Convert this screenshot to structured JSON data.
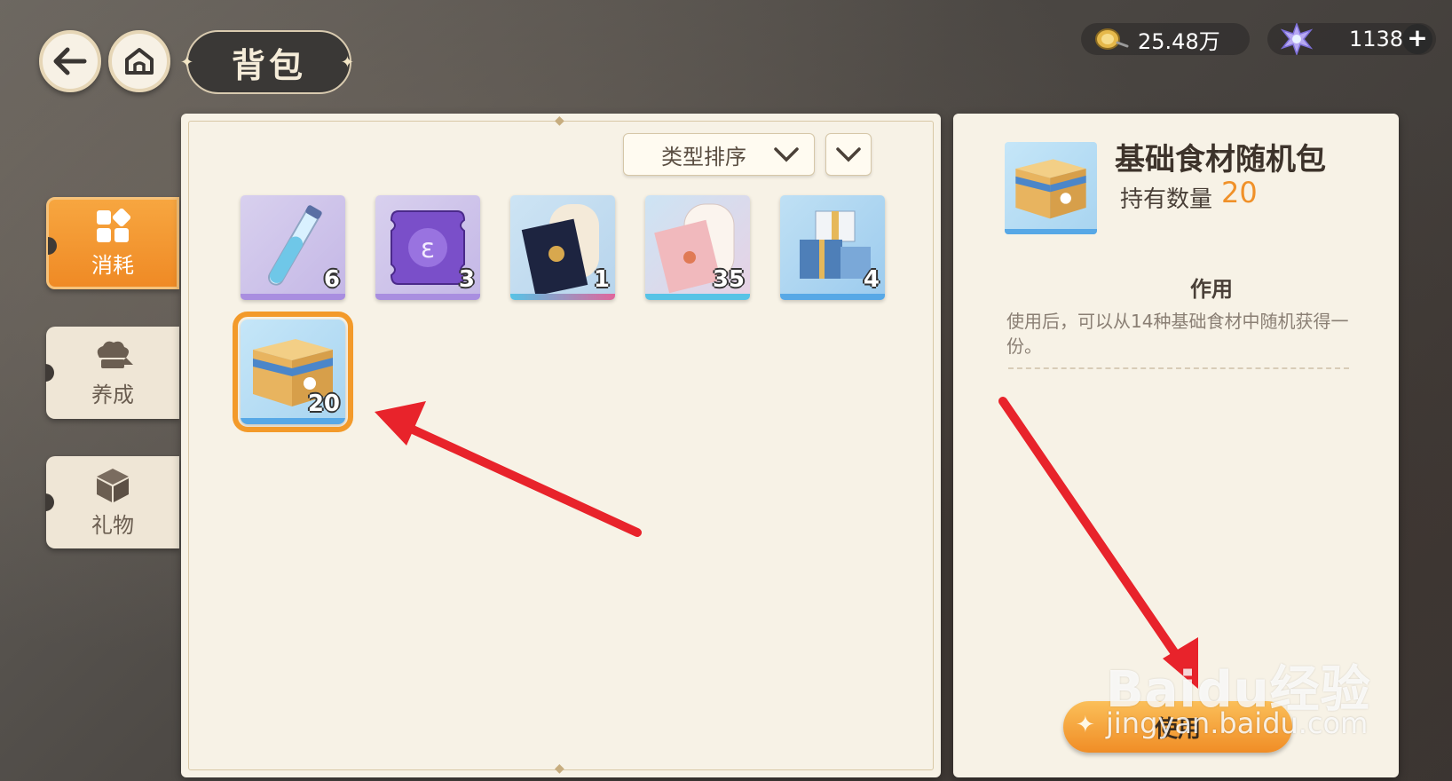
{
  "header": {
    "title": "背包",
    "back_icon": "back-arrow-icon",
    "home_icon": "home-icon"
  },
  "currency": {
    "gold": {
      "icon": "gold-coin-icon",
      "value": "25.48万"
    },
    "crystal": {
      "icon": "crystal-icon",
      "value": "1138"
    },
    "add_label": "+"
  },
  "sidebar": {
    "tabs": [
      {
        "label": "消耗",
        "icon": "grid-icon",
        "active": true
      },
      {
        "label": "养成",
        "icon": "chef-hat-icon",
        "active": false
      },
      {
        "label": "礼物",
        "icon": "gift-box-icon",
        "active": false
      }
    ]
  },
  "inventory": {
    "sort_label": "类型排序",
    "items": [
      {
        "icon": "test-tube-icon",
        "qty": "6",
        "rarity_color": "#a98ee0"
      },
      {
        "icon": "purple-ticket-icon",
        "qty": "3",
        "rarity_color": "#a98ee0"
      },
      {
        "icon": "black-letter-icon",
        "qty": "1",
        "rarity_color": "#e0669c"
      },
      {
        "icon": "pink-letter-icon",
        "qty": "35",
        "rarity_color": "#57c3e6"
      },
      {
        "icon": "gift-stack-icon",
        "qty": "4",
        "rarity_color": "#57a8e6"
      },
      {
        "icon": "ingredient-box-icon",
        "qty": "20",
        "rarity_color": "#57a8e6",
        "selected": true
      }
    ]
  },
  "detail": {
    "name": "基础食材随机包",
    "qty_label": "持有数量",
    "qty_value": "20",
    "effect_title": "作用",
    "effect_text": "使用后，可以从14种基础食材中随机获得一份。",
    "use_label": "使用"
  },
  "watermark": {
    "text": "Baidu经验",
    "url": "jingyan.baidu.com"
  },
  "colors": {
    "accent": "#f39a2a",
    "annotation_arrow": "#e8232b"
  }
}
